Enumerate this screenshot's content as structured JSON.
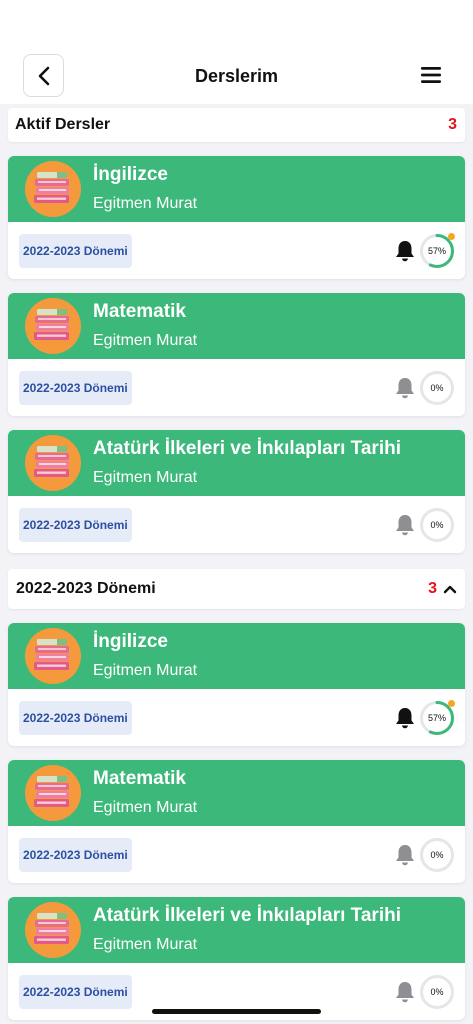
{
  "header": {
    "title": "Derslerim",
    "back_icon": "chevron-left-icon",
    "menu_icon": "hamburger-menu-icon"
  },
  "active_section": {
    "title": "Aktif Dersler",
    "count": "3"
  },
  "active_courses": [
    {
      "name": "İngilizce",
      "teacher": "Egitmen Murat",
      "term": "2022-2023 Dönemi",
      "progress_label": "57%",
      "progress": 57,
      "bell_active": true,
      "dot": true
    },
    {
      "name": "Matematik",
      "teacher": "Egitmen Murat",
      "term": "2022-2023 Dönemi",
      "progress_label": "0%",
      "progress": 0,
      "bell_active": false,
      "dot": false
    },
    {
      "name": "Atatürk İlkeleri ve İnkılapları Tarihi",
      "teacher": "Egitmen Murat",
      "term": "2022-2023 Dönemi",
      "progress_label": "0%",
      "progress": 0,
      "bell_active": false,
      "dot": false
    }
  ],
  "term_section": {
    "title": "2022-2023 Dönemi",
    "count": "3",
    "toggle_icon": "chevron-up-icon"
  },
  "term_courses": [
    {
      "name": "İngilizce",
      "teacher": "Egitmen Murat",
      "term": "2022-2023 Dönemi",
      "progress_label": "57%",
      "progress": 57,
      "bell_active": true,
      "dot": true
    },
    {
      "name": "Matematik",
      "teacher": "Egitmen Murat",
      "term": "2022-2023 Dönemi",
      "progress_label": "0%",
      "progress": 0,
      "bell_active": false,
      "dot": false
    },
    {
      "name": "Atatürk İlkeleri ve İnkılapları Tarihi",
      "teacher": "Egitmen Murat",
      "term": "2022-2023 Dönemi",
      "progress_label": "0%",
      "progress": 0,
      "bell_active": false,
      "dot": false
    }
  ],
  "colors": {
    "card_green": "#3cb87a",
    "count_red": "#e3141b",
    "badge_bg": "#e6ecf7",
    "badge_text": "#2c4fa3",
    "avatar_orange": "#f49a3c",
    "progress_green": "#3cb87a",
    "notify_dot": "#f5a623"
  }
}
